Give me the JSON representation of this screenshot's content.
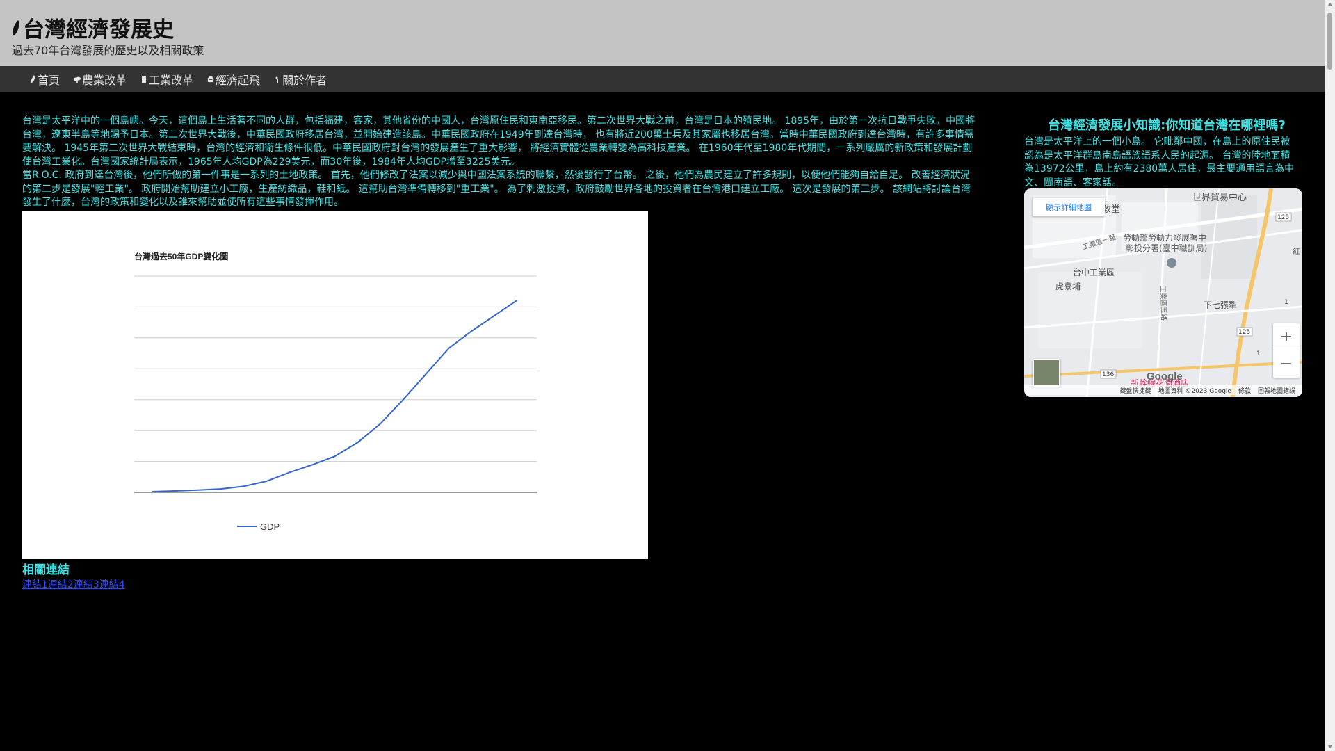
{
  "header": {
    "title": "台灣經濟發展史",
    "subtitle": "過去70年台灣發展的歷史以及相關政策"
  },
  "nav": {
    "items": [
      {
        "label": "首頁",
        "icon": "taiwan-leaf-icon"
      },
      {
        "label": "農業改革",
        "icon": "sprout-icon"
      },
      {
        "label": "工業改革",
        "icon": "factory-icon"
      },
      {
        "label": "經濟起飛",
        "icon": "money-bag-icon"
      },
      {
        "label": "關於作者",
        "icon": "person-icon"
      }
    ]
  },
  "main": {
    "para1": "台灣是太平洋中的一個島嶼。今天，這個島上生活著不同的人群，包括福建，客家，其他省份的中國人，台灣原住民和東南亞移民。第二次世界大戰之前，台灣是日本的殖民地。 1895年，由於第一次抗日戰爭失敗，中國將台灣，遼東半島等地賜予日本。第二次世界大戰後，中華民國政府移居台灣，並開始建造該島。中華民國政府在1949年到達台灣時， 也有將近200萬士兵及其家屬也移居台灣。當時中華民國政府到達台灣時，有許多事情需要解決。 1945年第二次世界大戰結束時，台灣的經濟和衛生條件很低。中華民國政府對台灣的發展產生了重大影響， 將經濟實體從農業轉變為高科技產業。 在1960年代至1980年代期間，一系列嚴厲的新政策和發展計劃使台灣工業化。台灣國家統計局表示，1965年人均GDP為229美元，而30年後，1984年人均GDP增至3225美元。",
    "para2": "當R.O.C. 政府到達台灣後，他們所做的第一件事是一系列的土地政策。 首先，他們修改了法案以減少與中國法案系統的聯繫，然後發行了台幣。 之後，他們為農民建立了許多規則，以便他們能夠自給自足。 改善經濟狀況的第二步是發展\"輕工業\"。 政府開始幫助建立小工廠，生產紡織品，鞋和紙。 這幫助台灣準備轉移到\"重工業\"。 為了刺激投資，政府鼓勵世界各地的投資者在台灣港口建立工廠。 這次是發展的第三步。 該網站將討論台灣發生了什麼，台灣的政策和變化以及誰來幫助並使所有這些事情發揮作用。"
  },
  "chart_data": {
    "type": "line",
    "title": "台灣過去50年GDP變化圖",
    "xlabel": "",
    "ylabel": "",
    "grid": true,
    "legend_position": "bottom",
    "series": [
      {
        "name": "GDP",
        "color": "#3366cc",
        "values": [
          0.4,
          0.8,
          1.3,
          2.0,
          3.5,
          6.5,
          11.5,
          16,
          21,
          29,
          40,
          54,
          69,
          84,
          94,
          103,
          112
        ]
      }
    ]
  },
  "links": {
    "heading": "相關連結",
    "items": [
      "連結1",
      "連結2",
      "連結3",
      "連結4"
    ]
  },
  "aside": {
    "title": "台灣經濟發展小知識:你知道台灣在哪裡嗎?",
    "text": "台灣是太平洋上的一個小島。 它毗鄰中國，在島上的原住民被認為是太平洋群島南島語族語系人民的起源。 台灣的陸地面積為13972公里，島上約有2380萬人居住，最主要通用語言為中文、閩南語、客家話。"
  },
  "map": {
    "view_larger": "顯示詳細地圖",
    "labels": {
      "world_trade": "世界貿易中心",
      "labor_dept": "勞動部勞動力發展署中",
      "labor_dept2": "彰投分署(臺中職訓局)",
      "industrial_zone": "台中工業區",
      "hu_liao": "虎寮埔",
      "xia_qi": "下七張犁",
      "road1": "工業區一路",
      "road2": "工業區五路",
      "hotel": "新幹線花園酒店",
      "partial_left": "敎堂",
      "partial_right": "紅",
      "route125a": "125",
      "route125b": "125",
      "route136": "136",
      "route1a": "1",
      "route1b": "1"
    },
    "footer": {
      "shortcuts": "鍵盤快捷鍵",
      "data": "地圖資料 ©2023 Google",
      "terms": "條款",
      "report": "回報地圖錯誤"
    },
    "google": "Google",
    "zoom_in": "+",
    "zoom_out": "−"
  }
}
